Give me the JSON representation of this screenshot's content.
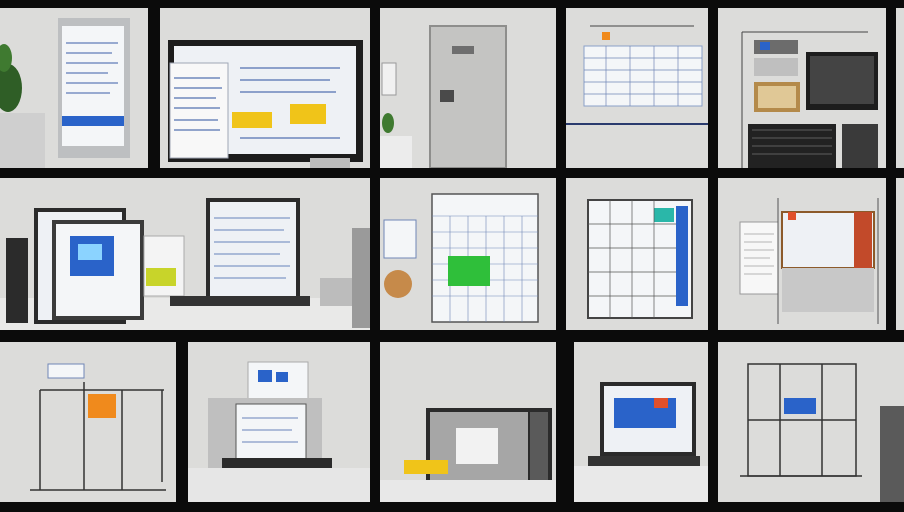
{
  "image": {
    "description_free": true
  },
  "colors": {
    "background": "#0b0b0b",
    "tile": "#dcdcda",
    "paper": "#f4f6f8",
    "blue": "#2a63c9",
    "yellow": "#f0c419",
    "orange": "#f08a1c",
    "green": "#2fbf3a",
    "dark": "#2b2b2b"
  }
}
